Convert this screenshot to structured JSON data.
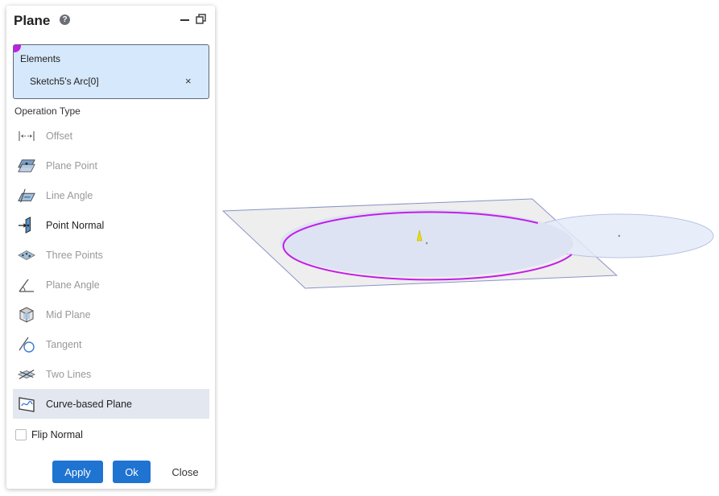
{
  "panel": {
    "title": "Plane",
    "help_glyph": "?",
    "icons": {
      "help": "help-icon",
      "minimize": "minimize-icon",
      "restore": "restore-window-icon"
    }
  },
  "elements": {
    "label": "Elements",
    "items": [
      {
        "text": "Sketch5's Arc[0]",
        "remove": "×"
      }
    ]
  },
  "operation_type": {
    "label": "Operation Type",
    "items": [
      {
        "label": "Offset",
        "icon": "offset-icon",
        "active": false
      },
      {
        "label": "Plane Point",
        "icon": "plane-point-icon",
        "active": false
      },
      {
        "label": "Line Angle",
        "icon": "line-angle-icon",
        "active": false
      },
      {
        "label": "Point Normal",
        "icon": "point-normal-icon",
        "active": false
      },
      {
        "label": "Three Points",
        "icon": "three-points-icon",
        "active": false
      },
      {
        "label": "Plane Angle",
        "icon": "plane-angle-icon",
        "active": false
      },
      {
        "label": "Mid Plane",
        "icon": "mid-plane-icon",
        "active": false
      },
      {
        "label": "Tangent",
        "icon": "tangent-icon",
        "active": false
      },
      {
        "label": "Two Lines",
        "icon": "two-lines-icon",
        "active": false
      },
      {
        "label": "Curve-based Plane",
        "icon": "curve-based-plane-icon",
        "active": true
      }
    ]
  },
  "flip_normal": {
    "label": "Flip Normal",
    "checked": false
  },
  "buttons": {
    "apply": "Apply",
    "ok": "Ok",
    "close": "Close"
  },
  "colors": {
    "accent": "#1f73d1",
    "selection": "#d6e8fb",
    "arc": "#c21ee8",
    "plane_fill": "#eeeeee",
    "disc_fill": "#dde3f3"
  }
}
